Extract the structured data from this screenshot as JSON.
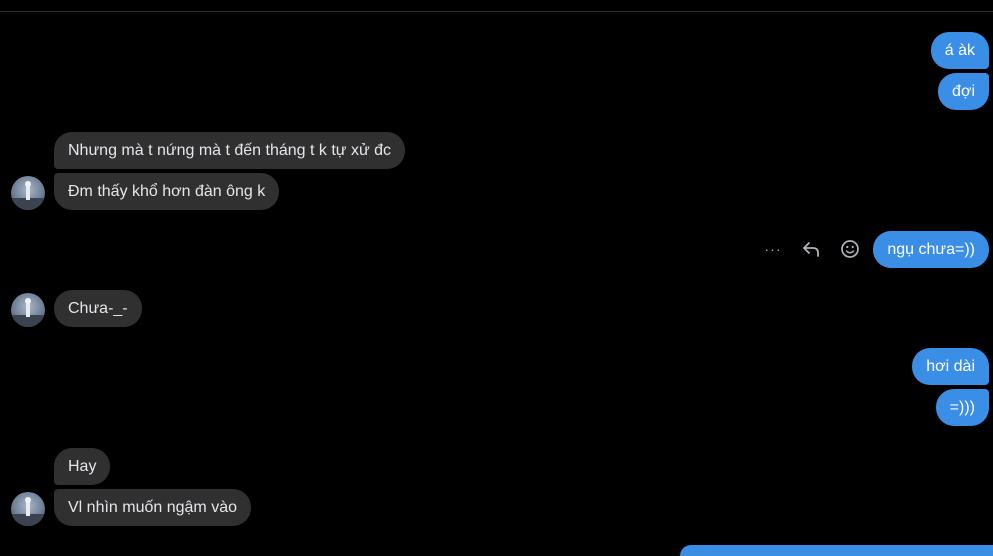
{
  "messages": {
    "outgoing_1": "á àk",
    "outgoing_2": "đợi",
    "incoming_1": "Nhưng mà t nứng mà t đến tháng t k tự xử đc",
    "incoming_2": "Đm thấy khổ hơn đàn ông k",
    "outgoing_3": "ngụ chưa=))",
    "incoming_3": "Chưa-_-",
    "outgoing_4": "hơi dài",
    "outgoing_5": "=)))",
    "incoming_4": "Hay",
    "incoming_5": "Vl nhìn muốn ngậm vào"
  },
  "actions": {
    "more": "···"
  },
  "colors": {
    "background": "#000000",
    "incoming_bubble": "#303030",
    "outgoing_bubble": "#3a8ee6"
  },
  "icons": [
    "avatar",
    "more-options-icon",
    "reply-icon",
    "emoji-react-icon"
  ]
}
